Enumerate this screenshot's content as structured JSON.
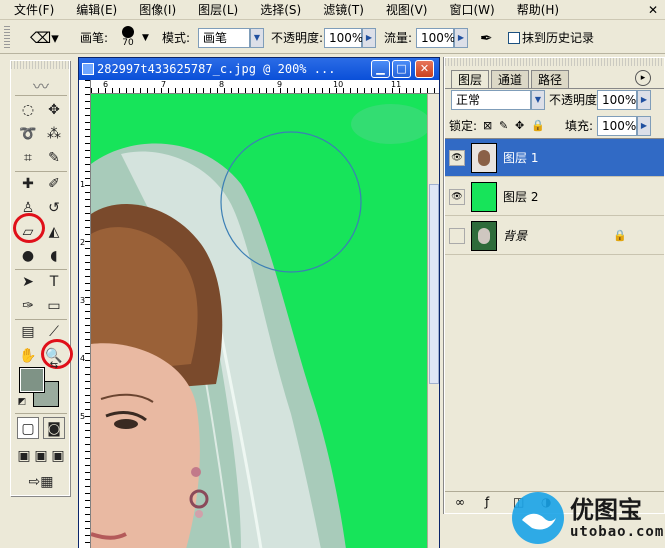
{
  "menu": {
    "items": [
      "文件(F)",
      "编辑(E)",
      "图像(I)",
      "图层(L)",
      "选择(S)",
      "滤镜(T)",
      "视图(V)",
      "窗口(W)",
      "帮助(H)"
    ]
  },
  "options": {
    "brush_label": "画笔:",
    "brush_size": "70",
    "mode_label": "模式:",
    "mode_value": "画笔",
    "opacity_label": "不透明度:",
    "opacity_value": "100%",
    "flow_label": "流量:",
    "flow_value": "100%",
    "history_label": "抹到历史记录"
  },
  "document": {
    "title": "282997t433625787_c.jpg @ 200% ...",
    "ruler_top": [
      "6",
      "7",
      "8",
      "9",
      "10",
      "11"
    ],
    "ruler_left": [
      "1",
      "2",
      "3",
      "4",
      "5"
    ]
  },
  "layers_panel": {
    "tabs": [
      "图层",
      "通道",
      "路径"
    ],
    "blend_mode": "正常",
    "opacity_label": "不透明度:",
    "opacity_value": "100%",
    "lock_label": "锁定:",
    "fill_label": "填充:",
    "fill_value": "100%",
    "layers": [
      {
        "name": "图层 1",
        "selected": true,
        "visible": true
      },
      {
        "name": "图层 2",
        "selected": false,
        "visible": true
      },
      {
        "name": "背景",
        "selected": false,
        "visible": false,
        "locked": true
      }
    ]
  },
  "watermark": {
    "brand": "优图宝",
    "domain": "utobao.com"
  },
  "colors": {
    "canvas_green": "#17e45a",
    "foreground": "#7f9386",
    "background": "#9aab9e",
    "selection": "#316ac5",
    "annotation_red": "#e0101a"
  }
}
